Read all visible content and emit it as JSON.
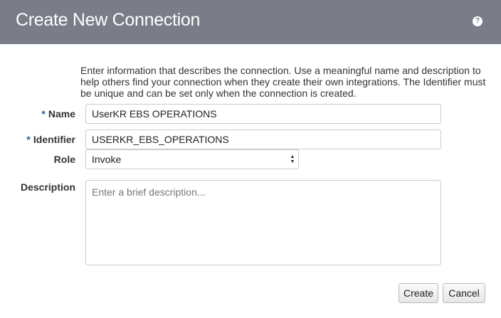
{
  "dialog": {
    "title": "Create New Connection",
    "help_icon": "question-circle-icon",
    "help_glyph": "?"
  },
  "intro_text": "Enter information that describes the connection. Use a meaningful name and description to help others find your connection when they create their own integrations. The Identifier must be unique and can be set only when the connection is created.",
  "form": {
    "required_marker": "*",
    "name": {
      "label": "Name",
      "value": "UserKR EBS OPERATIONS"
    },
    "identifier": {
      "label": "Identifier",
      "value": "USERKR_EBS_OPERATIONS"
    },
    "role": {
      "label": "Role",
      "selected": "Invoke",
      "arrow_up": "▲",
      "arrow_down": "▼"
    },
    "description": {
      "label": "Description",
      "placeholder": "Enter a brief description..."
    }
  },
  "buttons": {
    "create": "Create",
    "cancel": "Cancel"
  },
  "colors": {
    "header_bg": "#7a7d88",
    "required_marker": "#1f5ea8"
  }
}
